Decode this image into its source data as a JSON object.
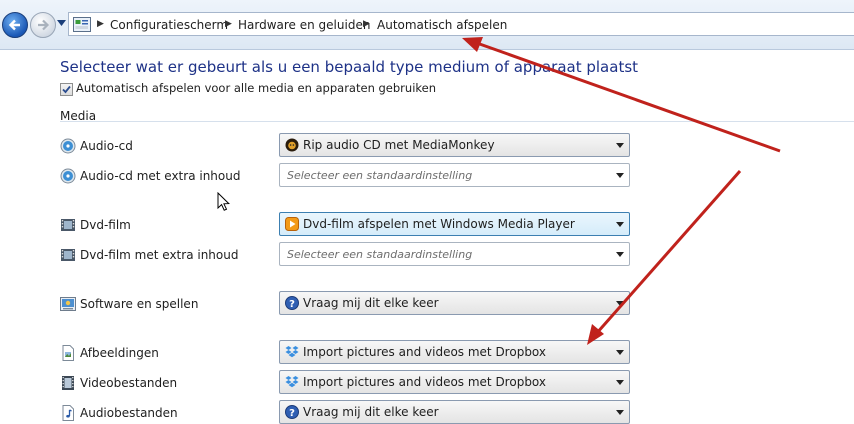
{
  "breadcrumb": {
    "items": [
      "Configuratiescherm",
      "Hardware en geluiden",
      "Automatisch afspelen"
    ]
  },
  "page": {
    "title": "Selecteer wat er gebeurt als u een bepaald type medium of apparaat plaatst",
    "autoplay_checkbox": {
      "label": "Automatisch afspelen voor alle media en apparaten gebruiken",
      "checked": true
    },
    "section": "Media"
  },
  "rows": [
    {
      "label": "Audio-cd",
      "icon": "cd-icon",
      "value": "Rip audio CD met MediaMonkey",
      "value_icon": "mediamonkey-icon"
    },
    {
      "label": "Audio-cd met extra inhoud",
      "icon": "cd-icon",
      "placeholder": "Selecteer een standaardinstelling"
    },
    {
      "label": "Dvd-film",
      "icon": "dvd-icon",
      "value": "Dvd-film afspelen met Windows Media Player",
      "value_icon": "media-player-icon"
    },
    {
      "label": "Dvd-film met extra inhoud",
      "icon": "dvd-icon",
      "placeholder": "Selecteer een standaardinstelling"
    },
    {
      "label": "Software en spellen",
      "icon": "software-icon",
      "value": "Vraag mij dit elke keer",
      "value_icon": "question-icon"
    },
    {
      "label": "Afbeeldingen",
      "icon": "image-file-icon",
      "value": "Import pictures and videos met Dropbox",
      "value_icon": "dropbox-icon"
    },
    {
      "label": "Videobestanden",
      "icon": "video-file-icon",
      "value": "Import pictures and videos met Dropbox",
      "value_icon": "dropbox-icon"
    },
    {
      "label": "Audiobestanden",
      "icon": "audio-file-icon",
      "value": "Vraag mij dit elke keer",
      "value_icon": "question-icon"
    }
  ],
  "colors": {
    "title": "#1e3287",
    "annotation_arrow": "#c0221c",
    "selected_dropdown": "#d5ecfa"
  }
}
